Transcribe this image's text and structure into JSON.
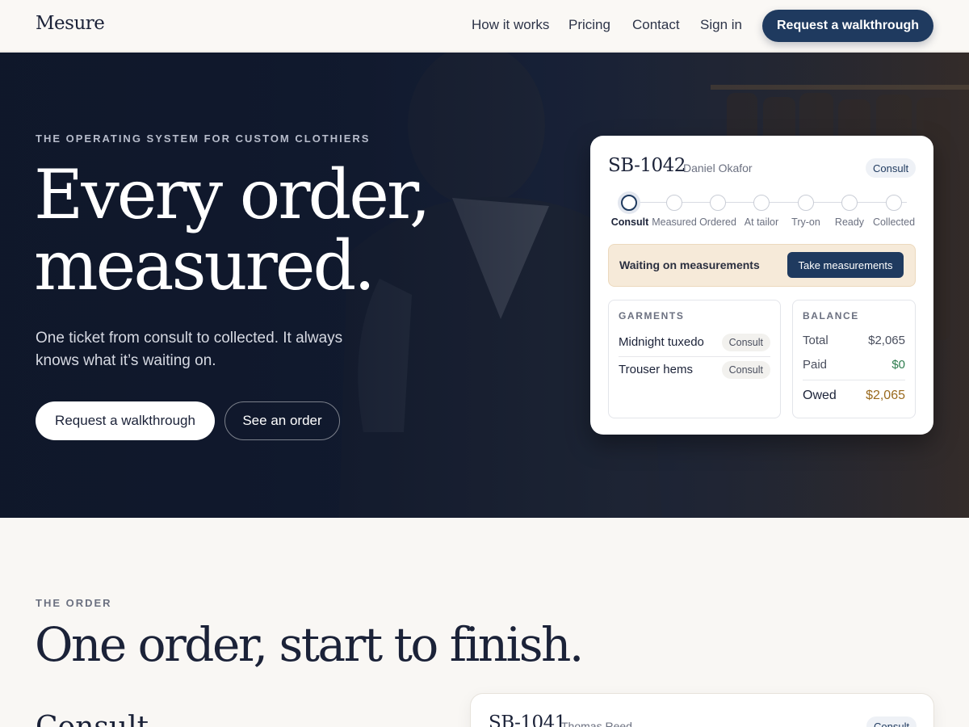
{
  "header": {
    "logo": "Mesure",
    "nav": [
      "How it works",
      "Pricing",
      "Contact",
      "Sign in"
    ],
    "cta": "Request a walkthrough"
  },
  "hero": {
    "eyebrow": "THE OPERATING SYSTEM FOR CUSTOM CLOTHIERS",
    "headline_line1": "Every order,",
    "headline_line2": "measured.",
    "subhead": "One ticket from consult to collected. It always knows what it’s waiting on.",
    "primary_button": "Request a walkthrough",
    "secondary_button": "See an order"
  },
  "order_card": {
    "order_id": "SB-1042",
    "client": "Daniel Okafor",
    "status": "Consult",
    "steps": [
      "Consult",
      "Measured",
      "Ordered",
      "At tailor",
      "Try-on",
      "Ready",
      "Collected"
    ],
    "active_step": 0,
    "waiting_text": "Waiting on measurements",
    "action_button": "Take measurements",
    "garments": {
      "title": "GARMENTS",
      "items": [
        {
          "name": "Midnight tuxedo",
          "status": "Consult"
        },
        {
          "name": "Trouser hems",
          "status": "Consult"
        }
      ]
    },
    "balance": {
      "title": "BALANCE",
      "total_label": "Total",
      "total_value": "$2,065",
      "paid_label": "Paid",
      "paid_value": "$0",
      "owed_label": "Owed",
      "owed_value": "$2,065"
    }
  },
  "order_section": {
    "eyebrow": "THE ORDER",
    "title": "One order, start to finish.",
    "step_heading": "Consult",
    "preview_card": {
      "order_id": "SB-1041",
      "client": "Thomas Reed",
      "status": "Consult"
    }
  },
  "colors": {
    "navy": "#1f3a5f",
    "hero_bg": "#121b30",
    "waiting_bg": "#f6ead9",
    "paid_green": "#2e7d4f",
    "owed_amber": "#9a6a1e"
  }
}
